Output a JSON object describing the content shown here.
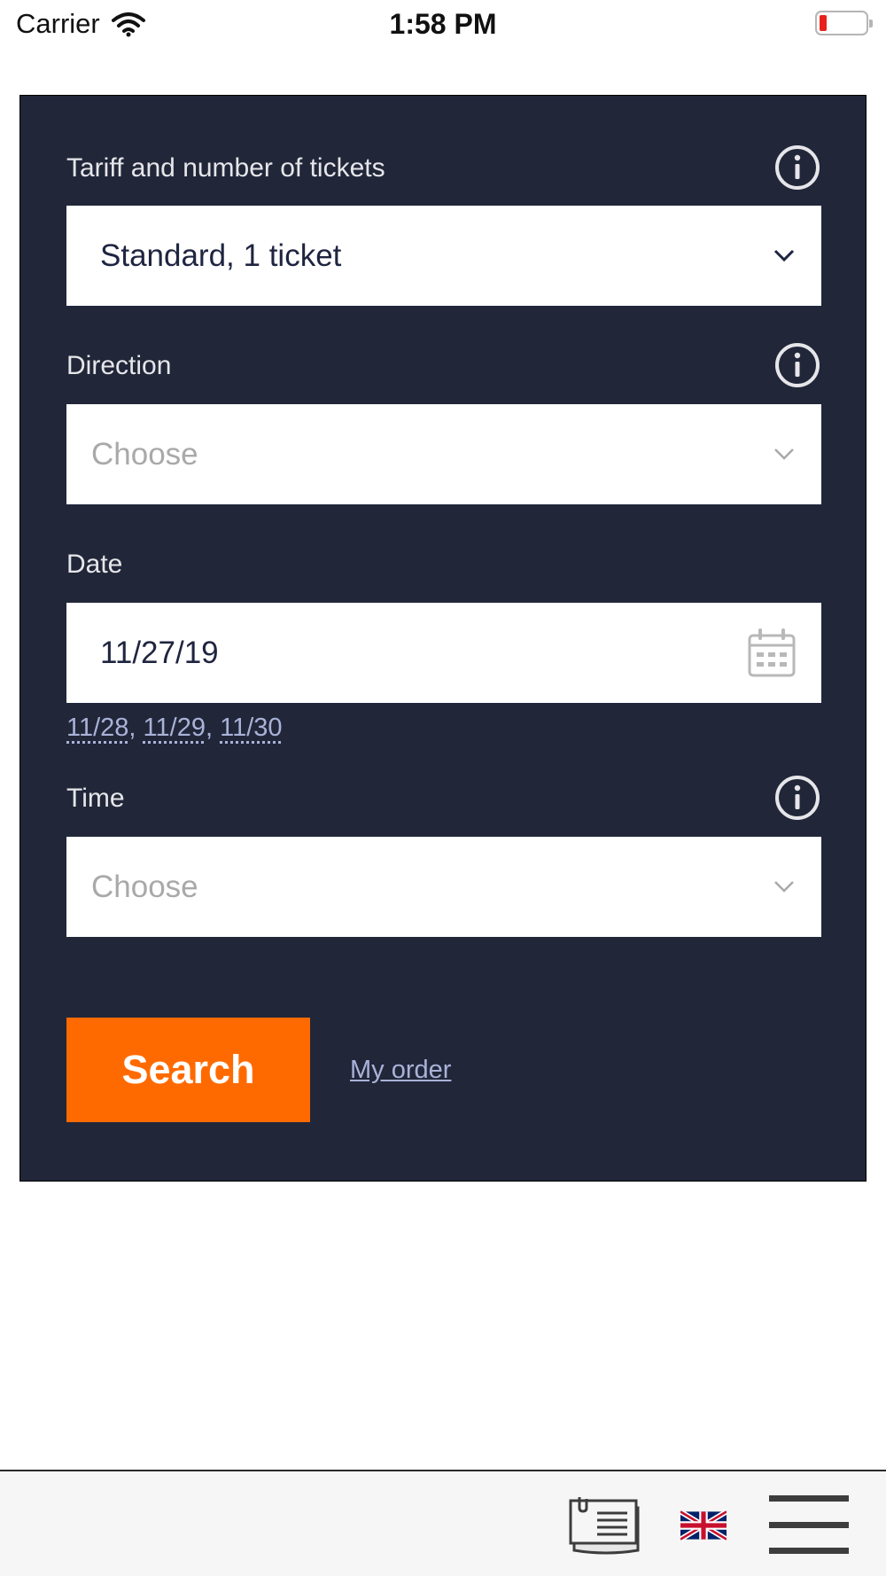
{
  "status_bar": {
    "carrier": "Carrier",
    "time": "1:58 PM",
    "icons": [
      "wifi-icon",
      "battery-icon"
    ]
  },
  "form": {
    "tariff": {
      "label": "Tariff and number of tickets",
      "value": "Standard, 1 ticket",
      "icon": "info-icon"
    },
    "direction": {
      "label": "Direction",
      "placeholder": "Choose",
      "icon": "info-icon"
    },
    "date": {
      "label": "Date",
      "value": "11/27/19",
      "icon": "calendar-icon",
      "quick_dates": [
        "11/28",
        "11/29",
        "11/30"
      ]
    },
    "time": {
      "label": "Time",
      "placeholder": "Choose",
      "icon": "info-icon"
    },
    "search_button": "Search",
    "my_order_link": "My order"
  },
  "bottom_bar": {
    "icons": [
      "ticket-icon",
      "uk-flag-icon",
      "hamburger-menu-icon"
    ]
  },
  "colors": {
    "panel_bg": "#212739",
    "accent": "#ff6a00",
    "link": "#a9b2d8",
    "battery_low": "#e8221b"
  }
}
